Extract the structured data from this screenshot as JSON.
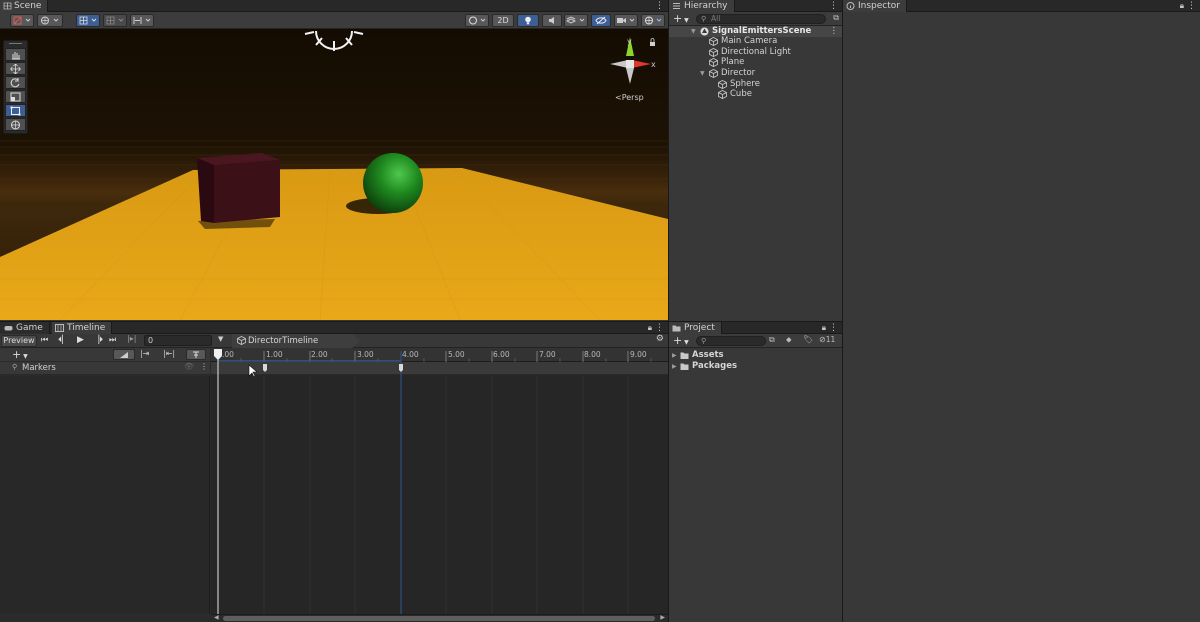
{
  "scene": {
    "tab_label": "Scene",
    "persp_label": "Persp",
    "toggle_2d": "2D",
    "gizmo_y": "y",
    "gizmo_x": "x"
  },
  "game": {
    "tab_label": "Game"
  },
  "timeline": {
    "tab_label": "Timeline",
    "preview_label": "Preview",
    "frame_value": "0",
    "asset_label": "DirectorTimeline (Director)",
    "ruler": [
      "1.00",
      "2.00",
      "3.00",
      "4.00",
      "5.00",
      "6.00",
      "7.00",
      "8.00",
      "9.00"
    ],
    "ruler_start": ".00",
    "track_name": "Markers"
  },
  "hierarchy": {
    "tab_label": "Hierarchy",
    "search_placeholder": "All",
    "scene_name": "SignalEmittersScene",
    "items": [
      "Main Camera",
      "Directional Light",
      "Plane",
      "Director",
      "Sphere",
      "Cube"
    ]
  },
  "inspector": {
    "tab_label": "Inspector"
  },
  "project": {
    "tab_label": "Project",
    "folders": [
      "Assets",
      "Packages"
    ],
    "hidden_count": "11"
  },
  "colors": {
    "accent": "#3e5f96",
    "plane": "#e6a417",
    "sphere": "#1f8a1f",
    "cube": "#3b1016"
  }
}
